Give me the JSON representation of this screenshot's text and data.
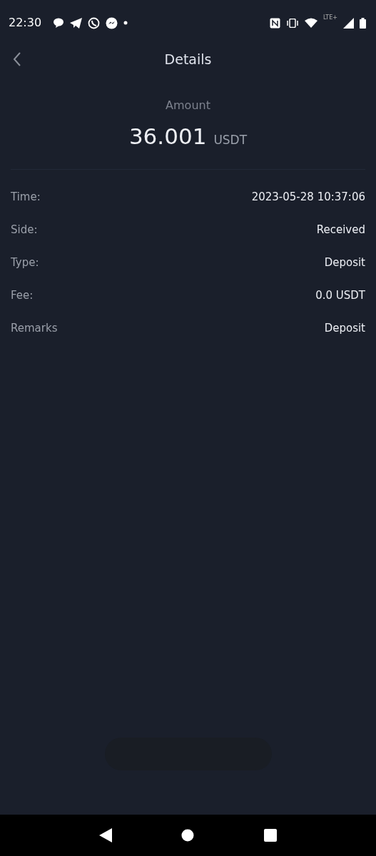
{
  "status_bar": {
    "time": "22:30",
    "network_label": "LTE+"
  },
  "header": {
    "title": "Details"
  },
  "amount": {
    "label": "Amount",
    "value": "36.001",
    "currency": "USDT"
  },
  "details": [
    {
      "label": "Time:",
      "value": "2023-05-28 10:37:06"
    },
    {
      "label": "Side:",
      "value": "Received"
    },
    {
      "label": "Type:",
      "value": "Deposit"
    },
    {
      "label": "Fee:",
      "value": "0.0 USDT"
    },
    {
      "label": "Remarks",
      "value": "Deposit"
    }
  ]
}
